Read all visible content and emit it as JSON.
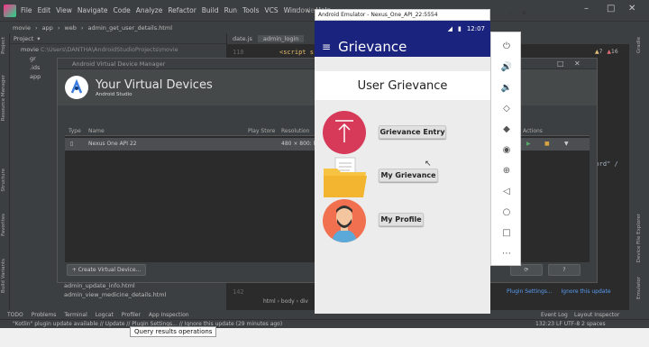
{
  "ide": {
    "menu": [
      "File",
      "Edit",
      "View",
      "Navigate",
      "Code",
      "Analyze",
      "Refactor",
      "Build",
      "Run",
      "Tools",
      "VCS",
      "Window",
      "Help"
    ],
    "project_title": "movie",
    "breadcrumb": [
      "movie",
      "app",
      "web",
      "admin_get_user_details.html"
    ],
    "project_path": "C:\\Users\\DANTHA\\AndroidStudioProjects\\movie",
    "project_dropdown": "Project",
    "tree": [
      "movie",
      "gr",
      ".ids",
      "app"
    ],
    "tree_files": [
      "admin_update_info.html",
      "admin_view_medicine_details.html"
    ],
    "left_tools": [
      "Project",
      "Resource Manager",
      "Structure",
      "Favorites",
      "Build Variants"
    ],
    "right_tools": [
      "Gradle",
      "Device File Explorer",
      "Emulator"
    ],
    "editor_tabs": [
      "date.js",
      "admin_login"
    ],
    "code_line_no": "118",
    "code_snippet": "<script sr",
    "code_right": "sword\"  /",
    "breadcrumb_bottom": [
      "html",
      "body",
      "div"
    ],
    "warning_count": "7",
    "error_count": "16",
    "plugin_links": [
      "Plugin Settings...",
      "Ignore this update"
    ],
    "bottom_tools": [
      "TODO",
      "Problems",
      "Terminal",
      "Logcat",
      "Profiler",
      "App Inspection"
    ],
    "bottom_right_tools": [
      "Event Log",
      "Layout Inspector"
    ],
    "status_text": "\"Kotlin\" plugin update available // Update // Plugin Settings... // Ignore this update (29 minutes ago)",
    "status_right": "132:23   LF   UTF-8   2 spaces",
    "line_no_bottom": "142"
  },
  "avd": {
    "window_title": "Android Virtual Device Manager",
    "heading": "Your Virtual Devices",
    "subheading": "Android Studio",
    "columns": [
      "Type",
      "Name",
      "Play Store",
      "Resolution",
      "Actions"
    ],
    "device_name": "Nexus One API 22",
    "device_resolution": "480 × 800: hdpi",
    "create_button": "+ Create Virtual Device...",
    "help_button": "?"
  },
  "emulator": {
    "window_title": "Android Emulator - Nexus_One_API_22:5554",
    "time": "12:07",
    "app_title": "Grievance",
    "screen_title": "User Grievance",
    "buttons": [
      "Grievance Entry",
      "My Grievance",
      "My Profile"
    ]
  },
  "taskbar": {
    "query_tooltip": "Query results operations"
  },
  "colors": {
    "app_bar": "#1a237e",
    "circle_red": "#d63a58",
    "circle_orange": "#f07050",
    "folder_yellow": "#f6c342"
  }
}
